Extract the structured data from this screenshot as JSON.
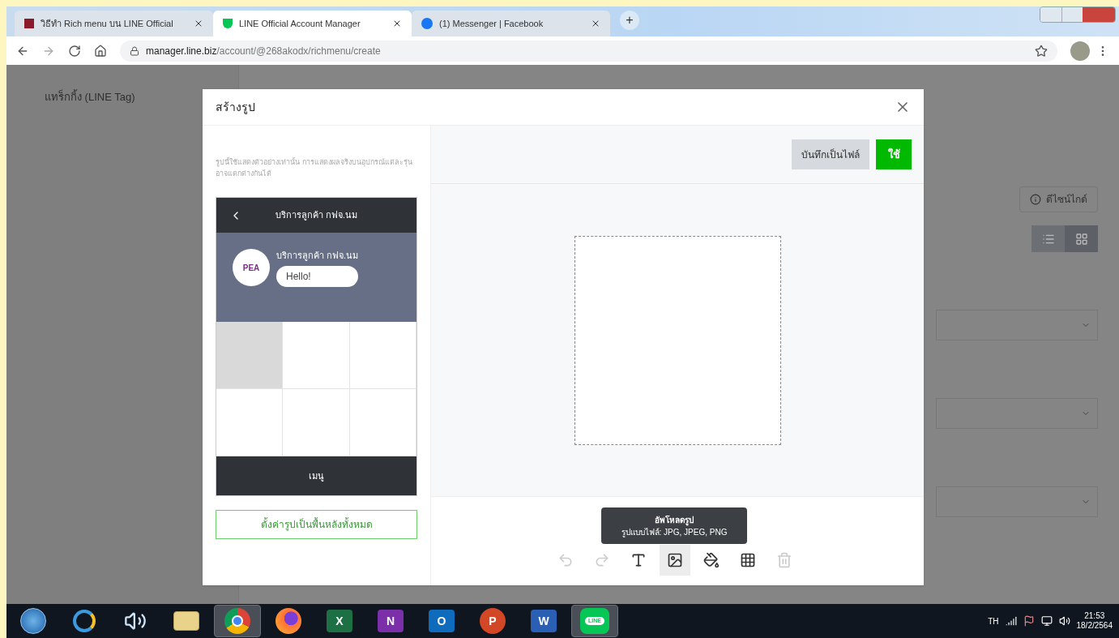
{
  "browser": {
    "tabs": [
      {
        "title": "วิธีทำ Rich menu บน LINE Official",
        "kind": "blog",
        "selected": false
      },
      {
        "title": "LINE Official Account Manager",
        "kind": "line",
        "selected": true
      },
      {
        "title": "(1) Messenger | Facebook",
        "kind": "facebook",
        "selected": false
      }
    ],
    "new_tab": "+",
    "url_host": "manager.line.biz",
    "url_path": "/account/@268akodx/richmenu/create"
  },
  "sidebar": {
    "items": [
      {
        "label": "แทร็กกิ้ง (LINE Tag)"
      }
    ]
  },
  "page": {
    "guide_button": "ดีไซน์ไกด์",
    "view_toggle": [
      {
        "kind": "list",
        "selected": false
      },
      {
        "kind": "grid",
        "selected": true
      }
    ]
  },
  "dialog": {
    "title": "สร้างรูป",
    "preview": {
      "note": "รูปนี้ใช้แสดงตัวอย่างเท่านั้น การแสดงผลจริงบนอุปกรณ์แต่ละรุ่น อาจแตกต่างกันได้",
      "header": "บริการลูกค้า กฟจ.นม",
      "sender": "บริการลูกค้า กฟจ.นม",
      "logo": "PEA",
      "message": "Hello!",
      "cells": [
        {
          "selected": true
        },
        {
          "selected": false
        },
        {
          "selected": false
        },
        {
          "selected": false
        },
        {
          "selected": false
        },
        {
          "selected": false
        }
      ],
      "menu_bar": "เมนู",
      "background_button": "ตั้งค่ารูปเป็นพื้นหลังทั้งหมด"
    },
    "save_button": "บันทึกเป็นไฟล์",
    "apply_button": "ใช้",
    "tools": [
      {
        "kind": "undo",
        "disabled": true,
        "selected": false
      },
      {
        "kind": "redo",
        "disabled": true,
        "selected": false
      },
      {
        "kind": "text",
        "disabled": false,
        "selected": false
      },
      {
        "kind": "image",
        "disabled": false,
        "selected": true
      },
      {
        "kind": "fill",
        "disabled": false,
        "selected": false
      },
      {
        "kind": "grid",
        "disabled": false,
        "selected": false
      },
      {
        "kind": "delete",
        "disabled": true,
        "selected": false
      }
    ],
    "tooltip": {
      "title": "อัพโหลดรูป",
      "body": "รูปแบบไฟล์: JPG, JPEG, PNG"
    }
  },
  "taskbar": {
    "apps": [
      {
        "kind": "start",
        "active": false
      },
      {
        "kind": "ie",
        "active": false
      },
      {
        "kind": "media",
        "active": false
      },
      {
        "kind": "folder",
        "active": false
      },
      {
        "kind": "chrome",
        "active": true
      },
      {
        "kind": "firefox",
        "active": false
      },
      {
        "kind": "office",
        "letter": "X",
        "color": "#1d7044",
        "active": false
      },
      {
        "kind": "office",
        "letter": "N",
        "color": "#7b2fa8",
        "active": false
      },
      {
        "kind": "office",
        "letter": "O",
        "color": "#0f6cbd",
        "active": false
      },
      {
        "kind": "round",
        "letter": "P",
        "color": "#d24726",
        "active": false
      },
      {
        "kind": "office",
        "letter": "W",
        "color": "#2b5fb4",
        "active": false
      },
      {
        "kind": "line",
        "letter": "LINE",
        "active": true
      }
    ],
    "language": "TH",
    "time": "21:53",
    "date": "18/2/2564"
  }
}
